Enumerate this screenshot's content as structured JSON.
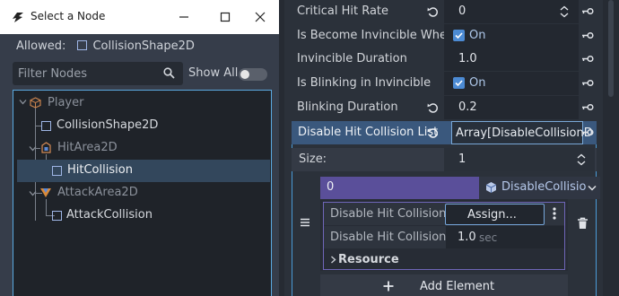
{
  "dialog": {
    "title": "Select a Node",
    "allowed_label": "Allowed:",
    "allowed_type": "CollisionShape2D",
    "filter_placeholder": "Filter Nodes",
    "show_all_label": "Show All",
    "show_all_checked": false,
    "tree": [
      {
        "label": "Player",
        "icon": "player-icon",
        "depth": 0,
        "dimmed": true
      },
      {
        "label": "CollisionShape2D",
        "icon": "collisionshape-icon",
        "depth": 1,
        "dimmed": false
      },
      {
        "label": "HitArea2D",
        "icon": "area2d-icon",
        "depth": 1,
        "dimmed": true
      },
      {
        "label": "HitCollision",
        "icon": "collisionshape-icon",
        "depth": 2,
        "dimmed": false,
        "selected": true
      },
      {
        "label": "AttackArea2D",
        "icon": "area2d-icon",
        "depth": 1,
        "dimmed": true
      },
      {
        "label": "AttackCollision",
        "icon": "collisionshape-icon",
        "depth": 2,
        "dimmed": false
      }
    ]
  },
  "inspector": {
    "properties": [
      {
        "name": "Critical Hit Rate",
        "value": "0",
        "has_reset": true,
        "spinner": true
      },
      {
        "name": "Is Become Invincible When",
        "value": "On",
        "checkbox": true
      },
      {
        "name": "Invincible Duration",
        "value": "1.0"
      },
      {
        "name": "Is Blinking in Invincible",
        "value": "On",
        "checkbox": true
      },
      {
        "name": "Blinking Duration",
        "value": "0.2",
        "has_reset": true
      }
    ],
    "array_property": {
      "name": "Disable Hit Collision List",
      "value": "Array[DisableCollisionD",
      "size_label": "Size:",
      "size_value": "1",
      "element": {
        "index": "0",
        "resource_type": "DisableCollisio",
        "fields": [
          {
            "name": "Disable Hit Collision N",
            "button": "Assign..."
          },
          {
            "name": "Disable Hit Collision D",
            "value": "1.0",
            "unit": "sec"
          }
        ],
        "section": "Resource"
      },
      "add_button": "Add Element"
    }
  },
  "colors": {
    "accent": "#4a9bd7",
    "selected_row": "#33475c",
    "element_header": "#5a4f9a",
    "checkbox": "#4c8bd4"
  }
}
